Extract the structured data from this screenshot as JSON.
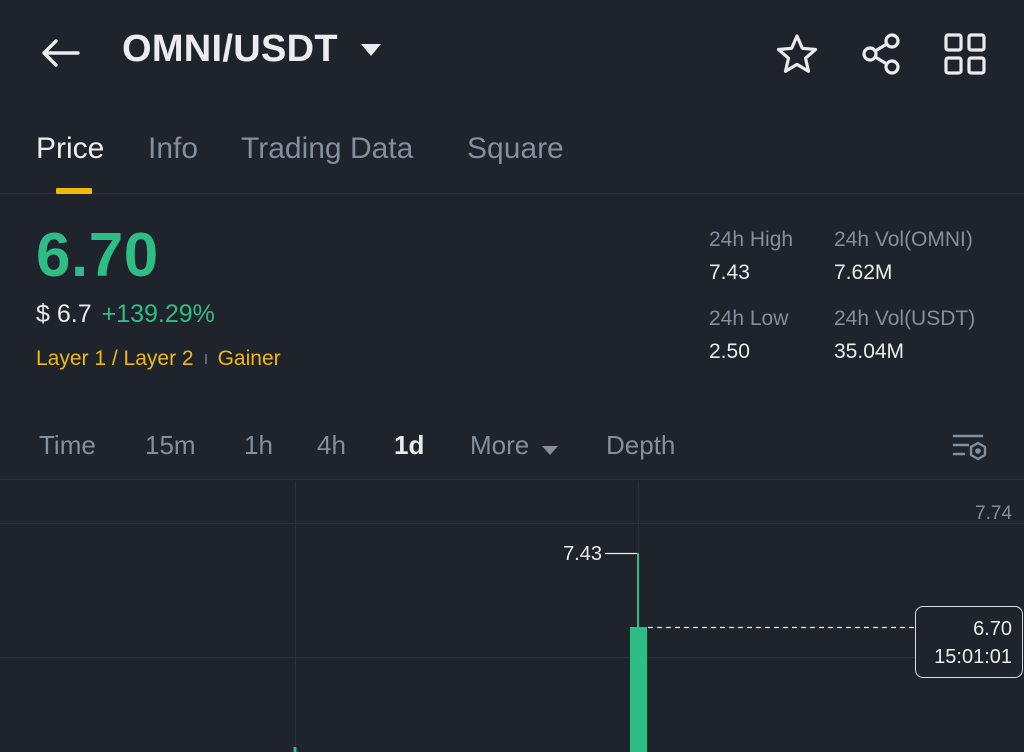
{
  "header": {
    "pair": "OMNI/USDT",
    "icons": [
      "back-arrow-icon",
      "chevron-down-icon",
      "star-icon",
      "share-icon",
      "grid-icon"
    ]
  },
  "tabs": [
    {
      "label": "Price",
      "active": true
    },
    {
      "label": "Info",
      "active": false
    },
    {
      "label": "Trading Data",
      "active": false
    },
    {
      "label": "Square",
      "active": false
    }
  ],
  "price": {
    "last": "6.70",
    "usd": "$ 6.7",
    "change": "+139.29%",
    "tags": [
      "Layer 1 / Layer 2",
      "Gainer"
    ]
  },
  "stats": {
    "high_label": "24h High",
    "high_value": "7.43",
    "low_label": "24h Low",
    "low_value": "2.50",
    "vol_base_label": "24h Vol(OMNI)",
    "vol_base_value": "7.62M",
    "vol_quote_label": "24h Vol(USDT)",
    "vol_quote_value": "35.04M"
  },
  "intervals": [
    {
      "label": "Time",
      "active": false
    },
    {
      "label": "15m",
      "active": false
    },
    {
      "label": "1h",
      "active": false
    },
    {
      "label": "4h",
      "active": false
    },
    {
      "label": "1d",
      "active": true
    },
    {
      "label": "More",
      "active": false
    },
    {
      "label": "Depth",
      "active": false
    }
  ],
  "chart": {
    "axis_top_label": "7.74",
    "high_marker": "7.43",
    "current_price": "6.70",
    "current_time": "15:01:01",
    "colors": {
      "up": "#2ebd85",
      "accent": "#f0b90b",
      "bg": "#1f232b"
    }
  }
}
